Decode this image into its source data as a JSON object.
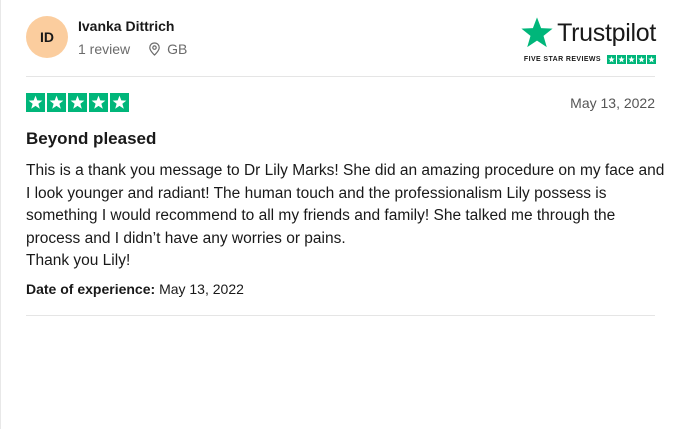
{
  "reviewer": {
    "initials": "ID",
    "name": "Ivanka Dittrich",
    "review_count": "1 review",
    "country": "GB"
  },
  "brand": {
    "name": "Trustpilot",
    "tagline": "FIVE STAR REVIEWS",
    "accent_color": "#00b67a"
  },
  "review": {
    "rating": 5,
    "max_rating": 5,
    "date": "May 13, 2022",
    "title": "Beyond pleased",
    "body": "This is a thank you message to Dr Lily Marks! She did an amazing procedure on my face and I look younger and radiant! The human touch and the professionalism Lily possess is something I would recommend to all my friends and family! She talked me through the process and I didn’t have any worries or pains.",
    "sign_off": "Thank you Lily!",
    "experience_label": "Date of experience:",
    "experience_date": "May 13, 2022"
  },
  "icons": {
    "location": "location-pin-icon",
    "star": "star-icon"
  }
}
